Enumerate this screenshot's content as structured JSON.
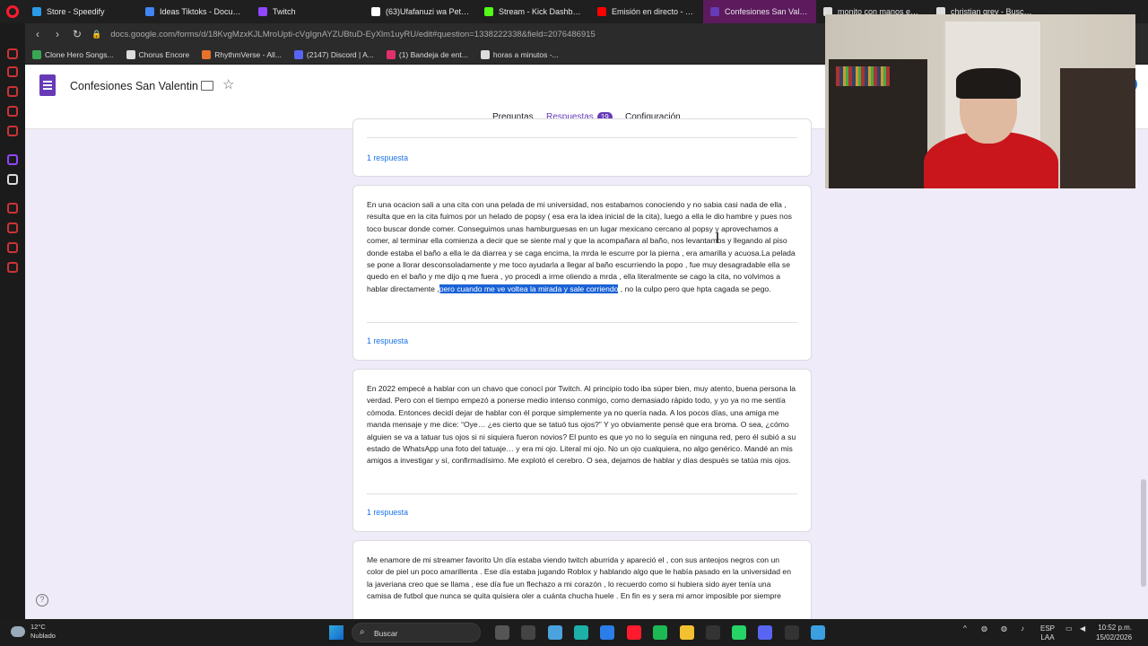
{
  "browser": {
    "tabs": [
      {
        "label": "Store - Speedify",
        "color": "#2b9ae8"
      },
      {
        "label": "Ideas Tiktoks - Documen",
        "color": "#4285f4"
      },
      {
        "label": "Twitch",
        "color": "#9146ff"
      },
      {
        "label": "(63)Ufafanuzi wa Pete za",
        "color": "#ffffff"
      },
      {
        "label": "Stream - Kick Dashboard",
        "color": "#53fc18"
      },
      {
        "label": "Emisión en directo - YouT",
        "color": "#ff0000"
      },
      {
        "label": "Confesiones San Valentin",
        "color": "#673ab7",
        "active": true
      },
      {
        "label": "monito con manos en la",
        "color": "#dddddd"
      },
      {
        "label": "christian grey - Buscar co",
        "color": "#dddddd"
      }
    ],
    "url": "docs.google.com/forms/d/18KvgMzxKJLMroUpti-cVgIgnAYZUBtuD-EyXlm1uyRU/edit#question=1338222338&field=2076486915",
    "bookmarks": [
      {
        "label": "Clone Hero Songs...",
        "color": "#3aa655"
      },
      {
        "label": "Chorus Encore",
        "color": "#dddddd"
      },
      {
        "label": "RhythmVerse - All...",
        "color": "#e8712b"
      },
      {
        "label": "(2147) Discord | A...",
        "color": "#5865f2"
      },
      {
        "label": "(1) Bandeja de ent...",
        "color": "#e1306c"
      },
      {
        "label": "horas a minutos -...",
        "color": "#dddddd"
      }
    ]
  },
  "form": {
    "title": "Confesiones San Valentin",
    "nav": {
      "preguntas": "Preguntas",
      "respuestas": "Respuestas",
      "respuestas_count": "19",
      "configuracion": "Configuración"
    },
    "response_link": "1 respuesta",
    "cards": [
      {
        "text_before": "En una ocacion sali a una cita con una pelada de mi universidad, nos estabamos conociendo y no sabia casi nada de ella , resulta que en la cita fuimos por un helado de popsy ( esa era la idea inicial de la cita), luego a ella le dio hambre y pues nos toco buscar donde comer. Conseguimos unas hamburguesas en un lugar mexicano cercano al popsy y aprovechamos a comer, al terminar ella comienza a decir que se siente mal y que la acompañara al baño, nos levantamos y llegando al piso donde estaba el baño a ella le da diarrea y se caga encima, la mrda le escurre por la pierna , era amarilla y acuosa.La pelada se pone a llorar desconsoladamente y me toco ayudarla a llegar al baño escurriendo la popo , fue muy desagradable ella se quedo en el baño y me dijo q me fuera , yo procedi a irme oliendo a mrda , ella literalmente se cago la cita, no volvimos a hablar directamente ,",
        "text_highlight": "pero cuando me ve voltea la mirada y sale corriendo",
        "text_after": " , no la culpo pero que hpta cagada se pego."
      },
      {
        "text": "En 2022 empecé a hablar con un chavo que conocí por Twitch. Al principio todo iba súper bien, muy atento, buena persona la verdad. Pero con el tiempo empezó a ponerse medio intenso conmigo, como demasiado rápido todo, y yo ya no me sentía cómoda. Entonces decidí dejar de hablar con él porque simplemente ya no quería nada. A los pocos días, una amiga me manda mensaje y me dice: “Oye… ¿es cierto que se tatuó tus ojos?” Y yo obviamente pensé que era broma. O sea, ¿cómo alguien se va a tatuar tus ojos si ni siquiera fueron novios? El punto es que yo no lo seguía en ninguna red, pero él subió a su estado de WhatsApp una foto del tatuaje… y era mi ojo. Literal mi ojo. No un ojo cualquiera, no algo genérico. Mandé an mis amigos a investigar y sí, confirmadísimo. Me explotó el cerebro. O sea, dejamos de hablar y días después se tatúa mis ojos."
      },
      {
        "text": "Me enamore de mi streamer favorito Un día estaba viendo twitch aburrida y apareció el , con sus anteojos negros con un color de piel un poco amarillenta . Ese día estaba jugando Roblox y hablando algo que le había pasado en la universidad en la javeriana creo que se llama , ese día fue un flechazo a mi corazón , lo recuerdo como si hubiera sido ayer tenía una camisa de futbol que nunca se quita quisiera oler a cuánta chucha huele . En fin es y sera mi amor imposible por siempre"
      }
    ]
  },
  "taskbar": {
    "weather_temp": "12°C",
    "weather_desc": "Nublado",
    "search_label": "Buscar",
    "lang_top": "ESP",
    "lang_bottom": "LAA",
    "time": "10:52 p.m.",
    "date": "15/02/2026",
    "apps": [
      {
        "name": "start-icon",
        "color": "#1e88e5"
      },
      {
        "name": "files-icon",
        "color": "#555555"
      },
      {
        "name": "terminal-icon",
        "color": "#444444"
      },
      {
        "name": "paint-icon",
        "color": "#4aa3df"
      },
      {
        "name": "edge-icon",
        "color": "#1db0a6"
      },
      {
        "name": "store-icon",
        "color": "#2b7de9"
      },
      {
        "name": "opera-icon",
        "color": "#ff1b2d"
      },
      {
        "name": "spotify-icon",
        "color": "#1db954"
      },
      {
        "name": "explorer-icon",
        "color": "#f3c130"
      },
      {
        "name": "epic-icon",
        "color": "#333333"
      },
      {
        "name": "whatsapp-icon",
        "color": "#25d366"
      },
      {
        "name": "discord-icon",
        "color": "#5865f2"
      },
      {
        "name": "obs-icon",
        "color": "#333333"
      },
      {
        "name": "notepad-icon",
        "color": "#3aa0e0"
      }
    ]
  }
}
